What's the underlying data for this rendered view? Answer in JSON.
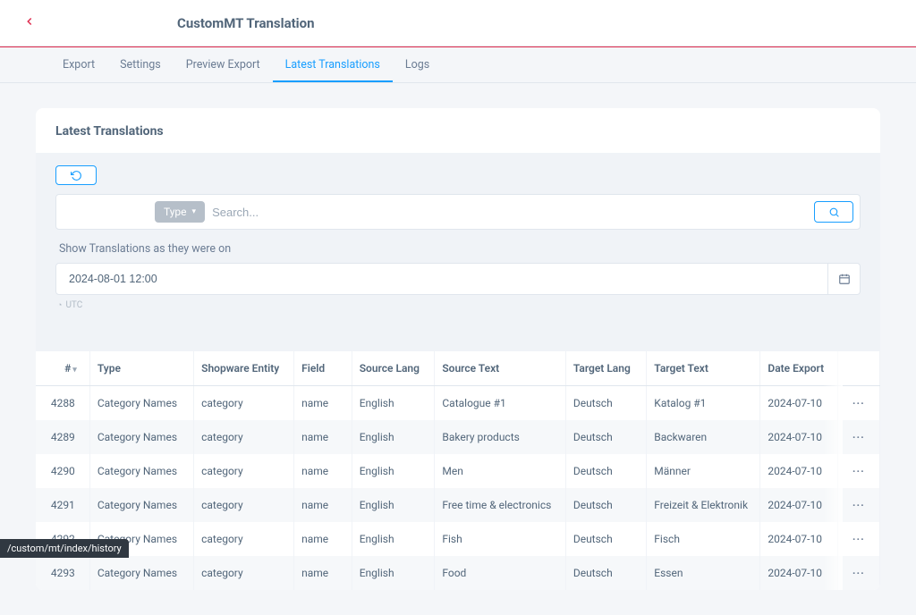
{
  "header": {
    "title": "CustomMT Translation"
  },
  "tabs": [
    {
      "label": "Export",
      "active": false
    },
    {
      "label": "Settings",
      "active": false
    },
    {
      "label": "Preview Export",
      "active": false
    },
    {
      "label": "Latest Translations",
      "active": true
    },
    {
      "label": "Logs",
      "active": false
    }
  ],
  "section_title": "Latest Translations",
  "filter": {
    "type_label": "Type",
    "search_placeholder": "Search..."
  },
  "date_filter": {
    "label": "Show Translations as they were on",
    "value": "2024-08-01 12:00",
    "tz": "UTC"
  },
  "columns": {
    "id": "#",
    "type": "Type",
    "entity": "Shopware Entity",
    "field": "Field",
    "src_lang": "Source Lang",
    "src_text": "Source Text",
    "tgt_lang": "Target Lang",
    "tgt_text": "Target Text",
    "date": "Date Export"
  },
  "rows": [
    {
      "id": "4288",
      "type": "Category Names",
      "entity": "category",
      "field": "name",
      "src_lang": "English",
      "src_text": "Catalogue #1",
      "tgt_lang": "Deutsch",
      "tgt_text": "Katalog #1",
      "date": "2024-07-10"
    },
    {
      "id": "4289",
      "type": "Category Names",
      "entity": "category",
      "field": "name",
      "src_lang": "English",
      "src_text": "Bakery products",
      "tgt_lang": "Deutsch",
      "tgt_text": "Backwaren",
      "date": "2024-07-10"
    },
    {
      "id": "4290",
      "type": "Category Names",
      "entity": "category",
      "field": "name",
      "src_lang": "English",
      "src_text": "Men",
      "tgt_lang": "Deutsch",
      "tgt_text": "Männer",
      "date": "2024-07-10"
    },
    {
      "id": "4291",
      "type": "Category Names",
      "entity": "category",
      "field": "name",
      "src_lang": "English",
      "src_text": "Free time & electronics",
      "tgt_lang": "Deutsch",
      "tgt_text": "Freizeit & Elektronik",
      "date": "2024-07-10"
    },
    {
      "id": "4292",
      "type": "Category Names",
      "entity": "category",
      "field": "name",
      "src_lang": "English",
      "src_text": "Fish",
      "tgt_lang": "Deutsch",
      "tgt_text": "Fisch",
      "date": "2024-07-10"
    },
    {
      "id": "4293",
      "type": "Category Names",
      "entity": "category",
      "field": "name",
      "src_lang": "English",
      "src_text": "Food",
      "tgt_lang": "Deutsch",
      "tgt_text": "Essen",
      "date": "2024-07-10"
    }
  ],
  "status_url": "/custom/mt/index/history"
}
